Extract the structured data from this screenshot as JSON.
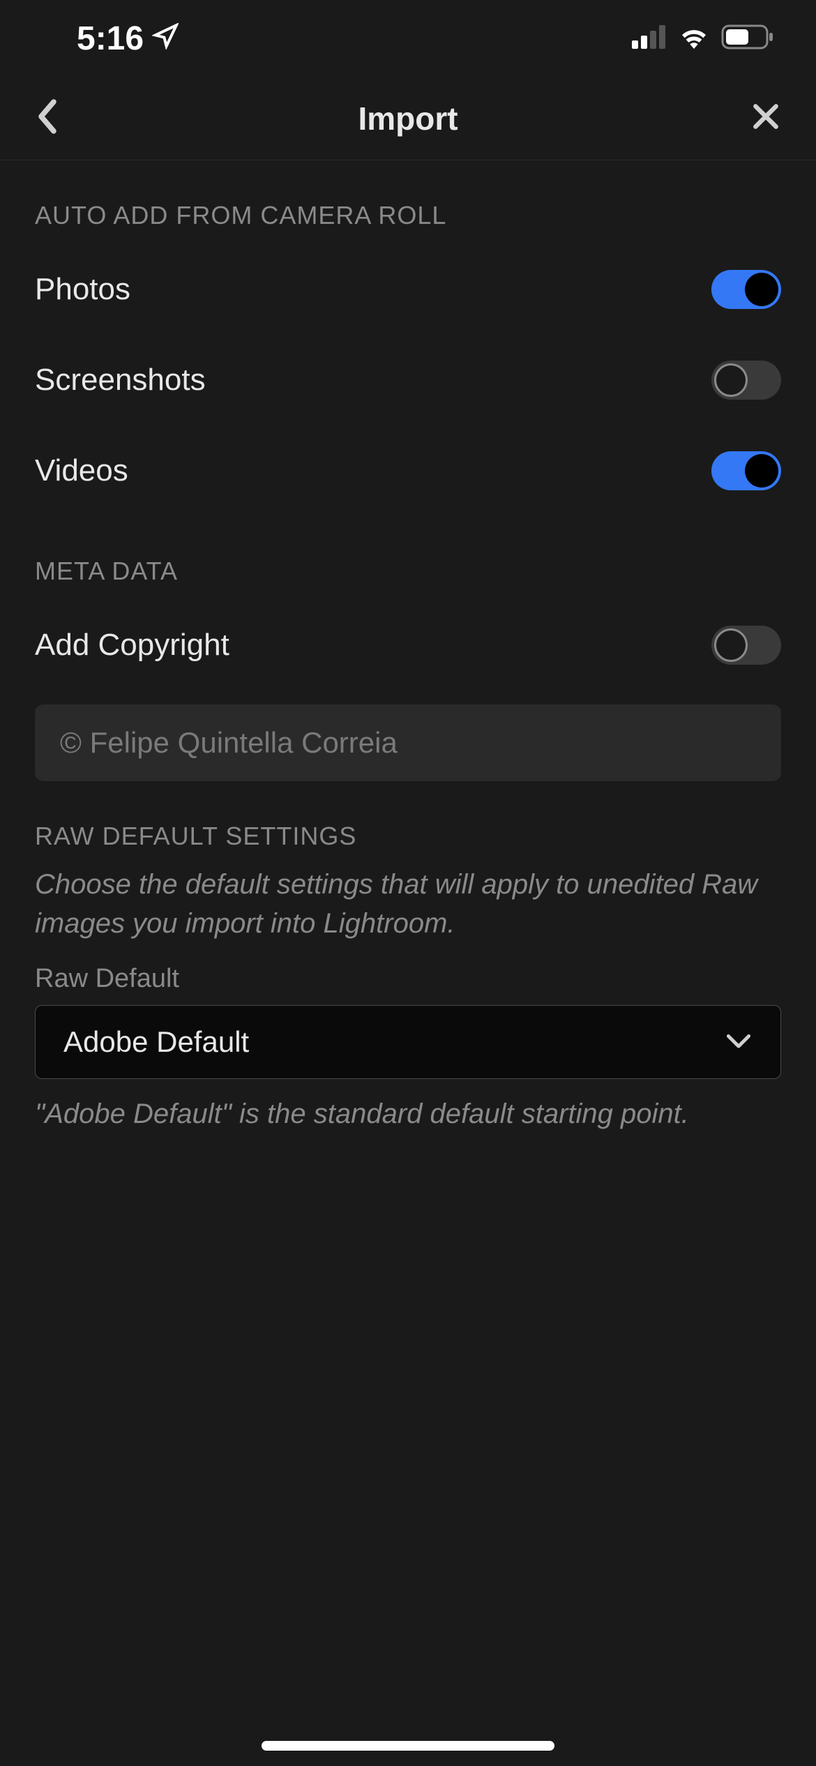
{
  "status_bar": {
    "time": "5:16"
  },
  "nav": {
    "title": "Import"
  },
  "sections": {
    "auto_add": {
      "header": "AUTO ADD FROM CAMERA ROLL",
      "photos": {
        "label": "Photos",
        "enabled": true
      },
      "screenshots": {
        "label": "Screenshots",
        "enabled": false
      },
      "videos": {
        "label": "Videos",
        "enabled": true
      }
    },
    "metadata": {
      "header": "META DATA",
      "copyright": {
        "label": "Add Copyright",
        "enabled": false,
        "value": "© Felipe Quintella Correia"
      }
    },
    "raw": {
      "header": "RAW DEFAULT SETTINGS",
      "description": "Choose the default settings that will apply to unedited Raw images you import into Lightroom.",
      "field_label": "Raw Default",
      "selected": "Adobe Default",
      "footer_note": "\"Adobe Default\" is the standard default starting point."
    }
  }
}
